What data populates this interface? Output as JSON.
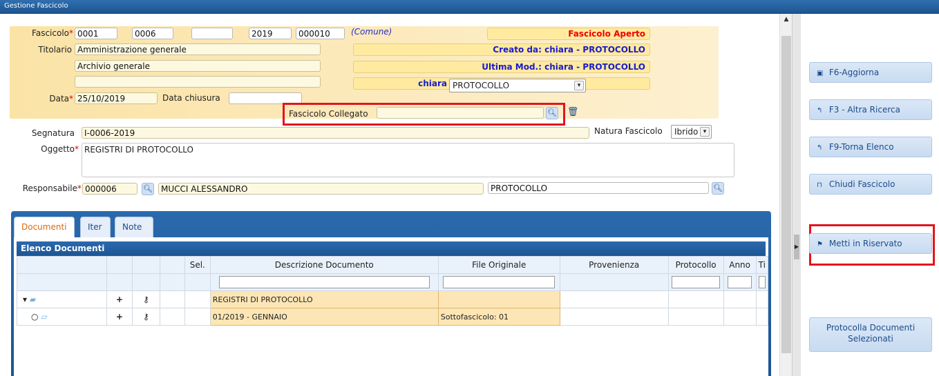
{
  "window": {
    "title": "Gestione Fascicolo"
  },
  "header": {
    "fascicolo_label": "Fascicolo",
    "fascicolo_fields": [
      "0001",
      "0006",
      "",
      "2019",
      "000010"
    ],
    "comune": "(Comune)",
    "status": "Fascicolo Aperto",
    "titolario_label": "Titolario",
    "titolario_1": "Amministrazione generale",
    "titolario_2": "Archivio generale",
    "titolario_3": "",
    "creato_da": "Creato da: chiara - PROTOCOLLO",
    "ultima_mod": "Ultima Mod.: chiara - PROTOCOLLO",
    "user": "chiara",
    "ufficio_select": "PROTOCOLLO",
    "data_label": "Data",
    "data_value": "25/10/2019",
    "data_chiusura_label": "Data chiusura",
    "data_chiusura_value": ""
  },
  "collegato": {
    "label": "Fascicolo Collegato",
    "value": ""
  },
  "form": {
    "segnatura_label": "Segnatura",
    "segnatura_value": "I-0006-2019",
    "natura_label": "Natura Fascicolo",
    "natura_value": "Ibrido",
    "oggetto_label": "Oggetto",
    "oggetto_value": "REGISTRI DI PROTOCOLLO",
    "responsabile_label": "Responsabile",
    "responsabile_code": "000006",
    "responsabile_name": "MUCCI ALESSANDRO",
    "responsabile_ufficio": "PROTOCOLLO"
  },
  "tabs": [
    {
      "label": "Documenti",
      "active": true
    },
    {
      "label": "Iter",
      "active": false
    },
    {
      "label": "Note",
      "active": false
    }
  ],
  "grid": {
    "title": "Elenco Documenti",
    "columns": [
      "",
      "",
      "",
      "",
      "Sel.",
      "Descrizione Documento",
      "File Originale",
      "Provenienza",
      "Protocollo",
      "Anno",
      "Ti"
    ],
    "rows": [
      {
        "tree": "▾",
        "add": "+",
        "key": "key-icon",
        "descrizione": "REGISTRI DI PROTOCOLLO",
        "file": ""
      },
      {
        "tree": "○",
        "add": "+",
        "key": "key-icon",
        "descrizione": "01/2019 - GENNAIO",
        "file": "Sottofascicolo: 01"
      }
    ]
  },
  "sidebar": {
    "aggiorna": "F6-Aggiorna",
    "altra_ricerca": "F3 - Altra Ricerca",
    "torna_elenco": "F9-Torna Elenco",
    "chiudi": "Chiudi Fascicolo",
    "riservato": "Metti in Riservato",
    "protocolla": "Protocolla Documenti Selezionati"
  },
  "colors": {
    "title_bar": "#1e5590",
    "header_bg": "#fbe3a6",
    "highlight_box": "#e3141b",
    "status_red": "#ee0000",
    "info_blue": "#1a1acc"
  }
}
